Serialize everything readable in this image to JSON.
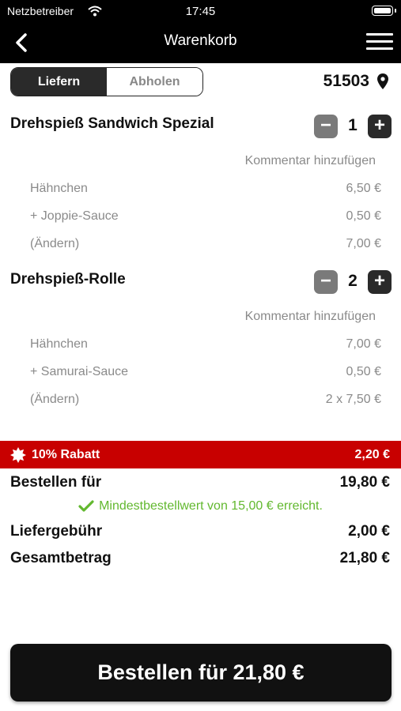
{
  "status": {
    "carrier": "Netzbetreiber",
    "time": "17:45"
  },
  "nav": {
    "title": "Warenkorb"
  },
  "mode": {
    "deliver": "Liefern",
    "pickup": "Abholen",
    "selected": "Liefern"
  },
  "location": {
    "zip": "51503"
  },
  "items": [
    {
      "name": "Drehspieß Sandwich Spezial",
      "quantity": "1",
      "comment": "Kommentar hinzufügen",
      "lines": [
        {
          "label": "Hähnchen",
          "price": "6,50 €"
        },
        {
          "label": "+ Joppie-Sauce",
          "price": "0,50 €"
        },
        {
          "label": "(Ändern)",
          "price": "7,00 €"
        }
      ]
    },
    {
      "name": "Drehspieß-Rolle",
      "quantity": "2",
      "comment": "Kommentar hinzufügen",
      "lines": [
        {
          "label": "Hähnchen",
          "price": "7,00 €"
        },
        {
          "label": "+ Samurai-Sauce",
          "price": "0,50 €"
        },
        {
          "label": "(Ändern)",
          "price": "2 x 7,50 €"
        }
      ]
    }
  ],
  "discount": {
    "label": "10% Rabatt",
    "amount": "2,20 €",
    "color": "#c80000"
  },
  "summary": {
    "order_for_label": "Bestellen für",
    "order_for_value": "19,80 €",
    "min_message": "Mindestbestellwert von 15,00 € erreicht.",
    "delivery_label": "Liefergebühr",
    "delivery_value": "2,00 €",
    "total_label": "Gesamtbetrag",
    "total_value": "21,80 €"
  },
  "order_button": {
    "label": "Bestellen für 21,80 €"
  },
  "colors": {
    "accent_green": "#62b82f",
    "dark": "#111111"
  }
}
